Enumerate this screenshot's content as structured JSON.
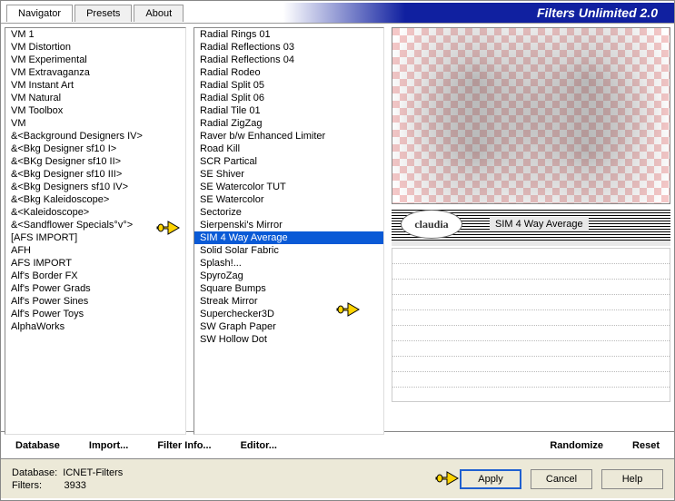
{
  "app_title": "Filters Unlimited 2.0",
  "tabs": {
    "navigator": "Navigator",
    "presets": "Presets",
    "about": "About"
  },
  "categories": [
    "VM 1",
    "VM Distortion",
    "VM Experimental",
    "VM Extravaganza",
    "VM Instant Art",
    "VM Natural",
    "VM Toolbox",
    "VM",
    "&<Background Designers IV>",
    "&<Bkg Designer sf10 I>",
    "&<BKg Designer sf10 II>",
    "&<Bkg Designer sf10 III>",
    "&<Bkg Designers sf10 IV>",
    "&<Bkg Kaleidoscope>",
    "&<Kaleidoscope>",
    "&<Sandflower Specials°v°>",
    "[AFS IMPORT]",
    "AFH",
    "AFS IMPORT",
    "Alf's Border FX",
    "Alf's Power Grads",
    "Alf's Power Sines",
    "Alf's Power Toys",
    "AlphaWorks"
  ],
  "category_selected_index": 11,
  "filters": [
    "Radial  Rings 01",
    "Radial Reflections 03",
    "Radial Reflections 04",
    "Radial Rodeo",
    "Radial Split 05",
    "Radial Split 06",
    "Radial Tile 01",
    "Radial ZigZag",
    "Raver b/w Enhanced Limiter",
    "Road Kill",
    "SCR  Partical",
    "SE Shiver",
    "SE Watercolor TUT",
    "SE Watercolor",
    "Sectorize",
    "Sierpenski's Mirror",
    "SIM 4 Way Average",
    "Solid Solar Fabric",
    "Splash!...",
    "SpyroZag",
    "Square Bumps",
    "Streak Mirror",
    "Superchecker3D",
    "SW Graph Paper",
    "SW Hollow Dot"
  ],
  "filter_selected_index": 16,
  "current_filter_name": "SIM 4 Way Average",
  "claudia_label": "claudia",
  "toolbar": {
    "database": "Database",
    "import": "Import...",
    "filter_info": "Filter Info...",
    "editor": "Editor...",
    "randomize": "Randomize",
    "reset": "Reset"
  },
  "footer": {
    "db_label": "Database:",
    "db_value": "ICNET-Filters",
    "filters_label": "Filters:",
    "filters_value": "3933",
    "apply": "Apply",
    "cancel": "Cancel",
    "help": "Help"
  }
}
